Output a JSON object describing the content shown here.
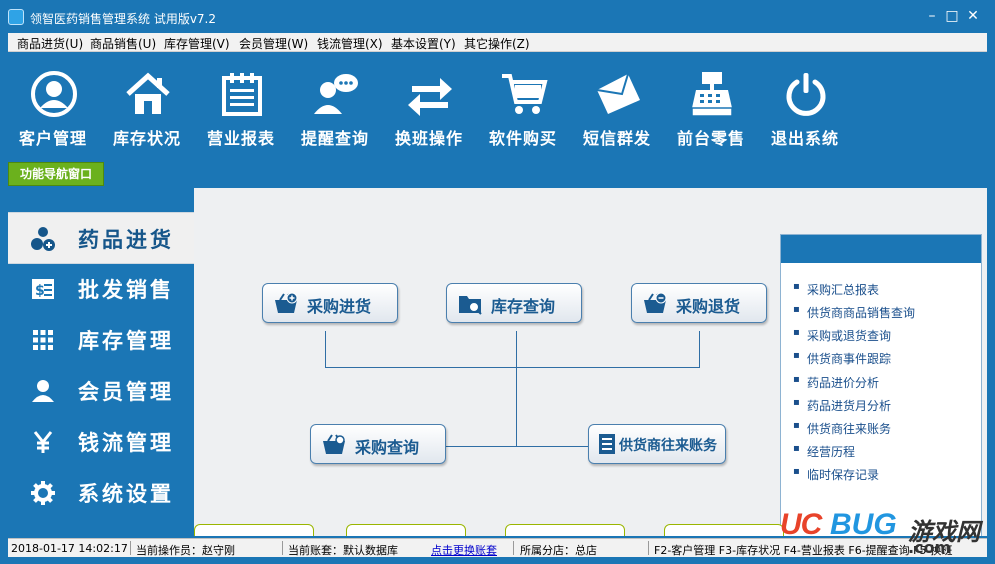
{
  "window": {
    "title": "领智医药销售管理系统 试用版v7.2",
    "min": "–",
    "max": "□",
    "close": "✕"
  },
  "menu": [
    "商品进货(U)",
    "商品销售(U)",
    "库存管理(V)",
    "会员管理(W)",
    "钱流管理(X)",
    "基本设置(Y)",
    "其它操作(Z)"
  ],
  "toolbar": [
    {
      "label": "客户管理",
      "icon": "user-circle-icon"
    },
    {
      "label": "库存状况",
      "icon": "house-icon"
    },
    {
      "label": "营业报表",
      "icon": "notepad-icon"
    },
    {
      "label": "提醒查询",
      "icon": "user-chat-icon"
    },
    {
      "label": "换班操作",
      "icon": "swap-arrows-icon"
    },
    {
      "label": "软件购买",
      "icon": "shopping-cart-icon"
    },
    {
      "label": "短信群发",
      "icon": "envelope-icon"
    },
    {
      "label": "前台零售",
      "icon": "cash-register-icon"
    },
    {
      "label": "退出系统",
      "icon": "power-icon"
    }
  ],
  "nav_tab": "功能导航窗口",
  "sidenav": [
    {
      "label": "药品进货",
      "icon": "pills-icon",
      "active": true
    },
    {
      "label": "批发销售",
      "icon": "invoice-icon"
    },
    {
      "label": "库存管理",
      "icon": "grid-icon"
    },
    {
      "label": "会员管理",
      "icon": "person-icon"
    },
    {
      "label": "钱流管理",
      "icon": "yen-icon"
    },
    {
      "label": "系统设置",
      "icon": "gear-icon"
    }
  ],
  "flow": {
    "purchase_in": "采购进货",
    "stock_query": "库存查询",
    "purchase_return": "采购退货",
    "purchase_query": "采购查询",
    "supplier_account": "供货商往来账务"
  },
  "right_links": [
    "采购汇总报表",
    "供货商商品销售查询",
    "采购或退货查询",
    "供货商事件跟踪",
    "药品进价分析",
    "药品进货月分析",
    "供货商往来账务",
    "经营历程",
    "临时保存记录"
  ],
  "status": {
    "datetime": "2018-01-17 14:02:17",
    "operator": "当前操作员：赵守刚",
    "account": "当前账套：默认数据库",
    "change_account": "点击更换账套",
    "branch": "所属分店：总店",
    "shortcuts": "F2-客户管理 F3-库存状况 F4-营业报表 F6-提醒查询 F5-换班"
  },
  "watermark": {
    "uc": "UC",
    "bug": "BUG",
    "cn": "游戏网",
    "com": ".com"
  },
  "colors": {
    "primary": "#1b76b5",
    "tab_green": "#6bb11d",
    "link": "#1a4f8c"
  }
}
